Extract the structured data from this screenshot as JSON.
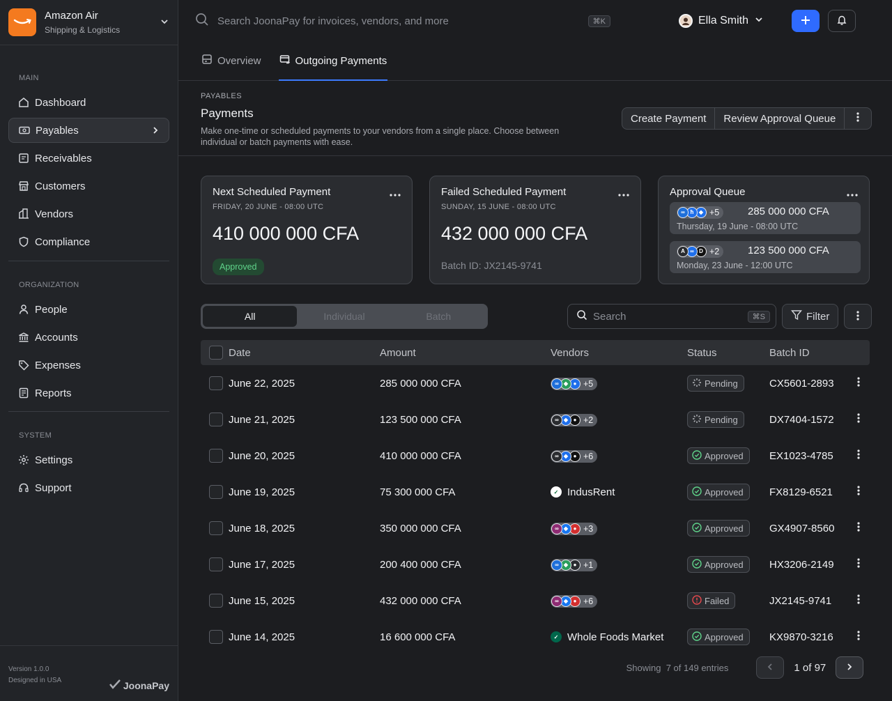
{
  "org": {
    "name": "Amazon Air",
    "sub": "Shipping & Logistics"
  },
  "nav": {
    "main_label": "MAIN",
    "main": [
      {
        "label": "Dashboard",
        "icon": "home-icon"
      },
      {
        "label": "Payables",
        "icon": "money-icon",
        "active": true
      },
      {
        "label": "Receivables",
        "icon": "receipt-icon"
      },
      {
        "label": "Customers",
        "icon": "store-icon"
      },
      {
        "label": "Vendors",
        "icon": "building-icon"
      },
      {
        "label": "Compliance",
        "icon": "shield-icon"
      }
    ],
    "org_label": "ORGANIZATION",
    "organization": [
      {
        "label": "People",
        "icon": "user-icon"
      },
      {
        "label": "Accounts",
        "icon": "bank-icon"
      },
      {
        "label": "Expenses",
        "icon": "tag-icon"
      },
      {
        "label": "Reports",
        "icon": "report-icon"
      }
    ],
    "system_label": "SYSTEM",
    "system": [
      {
        "label": "Settings",
        "icon": "gear-icon"
      },
      {
        "label": "Support",
        "icon": "headset-icon"
      }
    ]
  },
  "footer": {
    "version": "Version 1.0.0",
    "designed": "Designed in USA",
    "brand": "JoonaPay"
  },
  "topbar": {
    "search_placeholder": "Search JoonaPay for invoices, vendors, and more",
    "shortcut": "⌘K",
    "user_name": "Ella Smith"
  },
  "tabs": [
    {
      "label": "Overview"
    },
    {
      "label": "Outgoing Payments",
      "active": true
    }
  ],
  "header": {
    "crumb": "PAYABLES",
    "title": "Payments",
    "desc": "Make one-time or scheduled payments to your vendors from a single place. Choose between individual or batch payments with ease.",
    "create": "Create Payment",
    "review": "Review Approval Queue"
  },
  "cards": {
    "next": {
      "title": "Next Scheduled Payment",
      "sub": "FRIDAY, 20 JUNE - 08:00 UTC",
      "amount": "410 000 000 CFA",
      "status": "Approved"
    },
    "failed": {
      "title": "Failed Scheduled Payment",
      "sub": "SUNDAY, 15 JUNE - 08:00 UTC",
      "amount": "432 000 000 CFA",
      "batch": "Batch ID: JX2145-9741"
    },
    "queue": {
      "title": "Approval Queue",
      "items": [
        {
          "more": "+5",
          "amount": "285 000 000 CFA",
          "date": "Thursday, 19 June - 08:00 UTC"
        },
        {
          "more": "+2",
          "amount": "123 500 000 CFA",
          "date": "Monday, 23 June - 12:00 UTC"
        }
      ]
    }
  },
  "segments": [
    "All",
    "Individual",
    "Batch"
  ],
  "table_search": {
    "placeholder": "Search",
    "shortcut": "⌘S"
  },
  "filter_label": "Filter",
  "columns": [
    "Date",
    "Amount",
    "Vendors",
    "Status",
    "Batch ID"
  ],
  "rows": [
    {
      "date": "June 22, 2025",
      "amount": "285 000 000 CFA",
      "vendors": "+5",
      "status": "Pending",
      "batch": "CX5601-2893",
      "avs": [
        "#1e6fd9",
        "#2a9d5c",
        "#1f6feb"
      ]
    },
    {
      "date": "June 21, 2025",
      "amount": "123 500 000 CFA",
      "vendors": "+2",
      "status": "Pending",
      "batch": "DX7404-1572",
      "avs": [
        "#2a2c30",
        "#1f6feb",
        "#111"
      ]
    },
    {
      "date": "June 20, 2025",
      "amount": "410 000 000 CFA",
      "vendors": "+6",
      "status": "Approved",
      "batch": "EX1023-4785",
      "avs": [
        "#2a2c30",
        "#1f6feb",
        "#111"
      ]
    },
    {
      "date": "June 19, 2025",
      "amount": "75 300 000 CFA",
      "vendors": "IndusRent",
      "status": "Approved",
      "batch": "FX8129-6521",
      "single": true,
      "single_color": "#ffffff"
    },
    {
      "date": "June 18, 2025",
      "amount": "350 000 000 CFA",
      "vendors": "+3",
      "status": "Approved",
      "batch": "GX4907-8560",
      "avs": [
        "#8e2b73",
        "#1877f2",
        "#d32f2f"
      ]
    },
    {
      "date": "June 17, 2025",
      "amount": "200 400 000 CFA",
      "vendors": "+1",
      "status": "Approved",
      "batch": "HX3206-2149",
      "avs": [
        "#1e6fd9",
        "#2a9d5c",
        "#2a2c30"
      ]
    },
    {
      "date": "June 15, 2025",
      "amount": "432 000 000 CFA",
      "vendors": "+6",
      "status": "Failed",
      "batch": "JX2145-9741",
      "avs": [
        "#8e2b73",
        "#1877f2",
        "#d32f2f"
      ]
    },
    {
      "date": "June 14, 2025",
      "amount": "16 600 000 CFA",
      "vendors": "Whole Foods Market",
      "status": "Approved",
      "batch": "KX9870-3216",
      "single": true,
      "single_color": "#00674b"
    }
  ],
  "pager": {
    "info": "Showing  7 of 149 entries",
    "page": "1 of 97"
  },
  "colors": {
    "accent": "#2f6bff",
    "approved": "#5fd38a",
    "failed": "#e5484d",
    "brand_orange": "#f47a1f"
  }
}
